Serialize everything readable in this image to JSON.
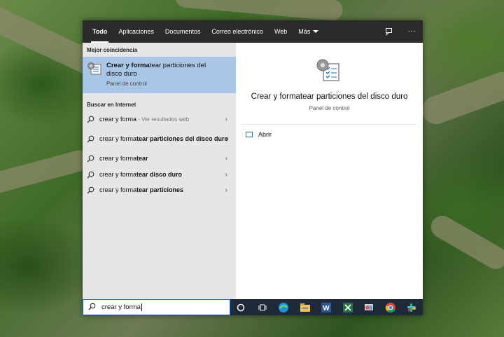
{
  "tabs": [
    "Todo",
    "Aplicaciones",
    "Documentos",
    "Correo electrónico",
    "Web",
    "Más"
  ],
  "top_icons": [
    "feedback-icon",
    "more-icon"
  ],
  "best_match": {
    "header": "Mejor coincidencia",
    "title_match": "Crear y forma",
    "title_rest": "tear particiones del disco duro",
    "subtitle": "Panel de control"
  },
  "web": {
    "header": "Buscar en Internet",
    "items": [
      {
        "match": "crear y forma",
        "rest": "",
        "extra": " - Ver resultados web"
      },
      {
        "match": "crear y forma",
        "rest": "tear particiones del disco duro",
        "extra": ""
      },
      {
        "match": "crear y forma",
        "rest": "tear",
        "extra": ""
      },
      {
        "match": "crear y forma",
        "rest": "tear disco duro",
        "extra": ""
      },
      {
        "match": "crear y forma",
        "rest": "tear particiones",
        "extra": ""
      }
    ]
  },
  "preview": {
    "title": "Crear y formatear particiones del disco duro",
    "subtitle": "Panel de control",
    "action": "Abrir"
  },
  "search": {
    "value": "crear y forma"
  },
  "taskbar": [
    "cortana-icon",
    "task-view-icon",
    "edge-icon",
    "file-explorer-icon",
    "word-icon",
    "excel-icon",
    "control-panel-icon",
    "chrome-icon",
    "slack-icon"
  ],
  "colors": {
    "accent": "#2d6cc0",
    "selection": "#a9c6e7",
    "topbar": "#2b2b2b"
  }
}
